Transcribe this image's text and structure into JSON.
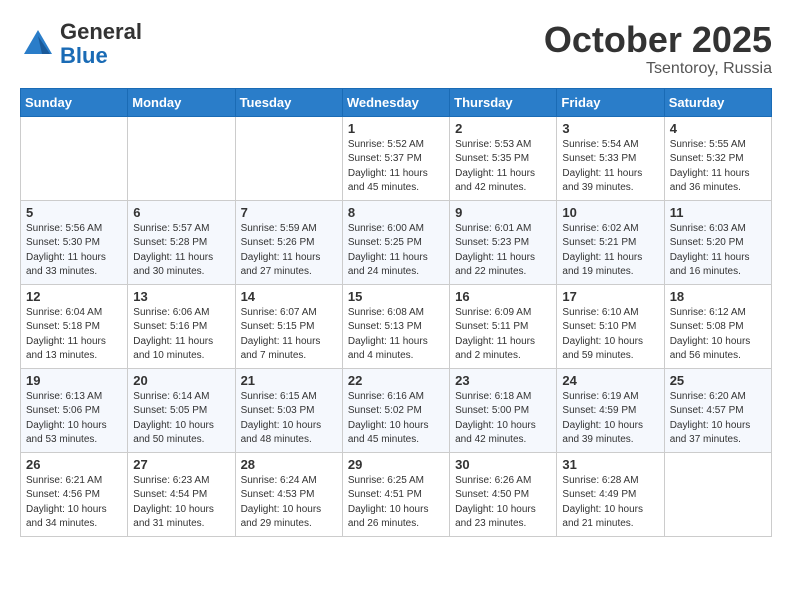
{
  "header": {
    "logo_general": "General",
    "logo_blue": "Blue",
    "month": "October 2025",
    "location": "Tsentoroy, Russia"
  },
  "weekdays": [
    "Sunday",
    "Monday",
    "Tuesday",
    "Wednesday",
    "Thursday",
    "Friday",
    "Saturday"
  ],
  "weeks": [
    [
      {
        "day": "",
        "info": ""
      },
      {
        "day": "",
        "info": ""
      },
      {
        "day": "",
        "info": ""
      },
      {
        "day": "1",
        "info": "Sunrise: 5:52 AM\nSunset: 5:37 PM\nDaylight: 11 hours\nand 45 minutes."
      },
      {
        "day": "2",
        "info": "Sunrise: 5:53 AM\nSunset: 5:35 PM\nDaylight: 11 hours\nand 42 minutes."
      },
      {
        "day": "3",
        "info": "Sunrise: 5:54 AM\nSunset: 5:33 PM\nDaylight: 11 hours\nand 39 minutes."
      },
      {
        "day": "4",
        "info": "Sunrise: 5:55 AM\nSunset: 5:32 PM\nDaylight: 11 hours\nand 36 minutes."
      }
    ],
    [
      {
        "day": "5",
        "info": "Sunrise: 5:56 AM\nSunset: 5:30 PM\nDaylight: 11 hours\nand 33 minutes."
      },
      {
        "day": "6",
        "info": "Sunrise: 5:57 AM\nSunset: 5:28 PM\nDaylight: 11 hours\nand 30 minutes."
      },
      {
        "day": "7",
        "info": "Sunrise: 5:59 AM\nSunset: 5:26 PM\nDaylight: 11 hours\nand 27 minutes."
      },
      {
        "day": "8",
        "info": "Sunrise: 6:00 AM\nSunset: 5:25 PM\nDaylight: 11 hours\nand 24 minutes."
      },
      {
        "day": "9",
        "info": "Sunrise: 6:01 AM\nSunset: 5:23 PM\nDaylight: 11 hours\nand 22 minutes."
      },
      {
        "day": "10",
        "info": "Sunrise: 6:02 AM\nSunset: 5:21 PM\nDaylight: 11 hours\nand 19 minutes."
      },
      {
        "day": "11",
        "info": "Sunrise: 6:03 AM\nSunset: 5:20 PM\nDaylight: 11 hours\nand 16 minutes."
      }
    ],
    [
      {
        "day": "12",
        "info": "Sunrise: 6:04 AM\nSunset: 5:18 PM\nDaylight: 11 hours\nand 13 minutes."
      },
      {
        "day": "13",
        "info": "Sunrise: 6:06 AM\nSunset: 5:16 PM\nDaylight: 11 hours\nand 10 minutes."
      },
      {
        "day": "14",
        "info": "Sunrise: 6:07 AM\nSunset: 5:15 PM\nDaylight: 11 hours\nand 7 minutes."
      },
      {
        "day": "15",
        "info": "Sunrise: 6:08 AM\nSunset: 5:13 PM\nDaylight: 11 hours\nand 4 minutes."
      },
      {
        "day": "16",
        "info": "Sunrise: 6:09 AM\nSunset: 5:11 PM\nDaylight: 11 hours\nand 2 minutes."
      },
      {
        "day": "17",
        "info": "Sunrise: 6:10 AM\nSunset: 5:10 PM\nDaylight: 10 hours\nand 59 minutes."
      },
      {
        "day": "18",
        "info": "Sunrise: 6:12 AM\nSunset: 5:08 PM\nDaylight: 10 hours\nand 56 minutes."
      }
    ],
    [
      {
        "day": "19",
        "info": "Sunrise: 6:13 AM\nSunset: 5:06 PM\nDaylight: 10 hours\nand 53 minutes."
      },
      {
        "day": "20",
        "info": "Sunrise: 6:14 AM\nSunset: 5:05 PM\nDaylight: 10 hours\nand 50 minutes."
      },
      {
        "day": "21",
        "info": "Sunrise: 6:15 AM\nSunset: 5:03 PM\nDaylight: 10 hours\nand 48 minutes."
      },
      {
        "day": "22",
        "info": "Sunrise: 6:16 AM\nSunset: 5:02 PM\nDaylight: 10 hours\nand 45 minutes."
      },
      {
        "day": "23",
        "info": "Sunrise: 6:18 AM\nSunset: 5:00 PM\nDaylight: 10 hours\nand 42 minutes."
      },
      {
        "day": "24",
        "info": "Sunrise: 6:19 AM\nSunset: 4:59 PM\nDaylight: 10 hours\nand 39 minutes."
      },
      {
        "day": "25",
        "info": "Sunrise: 6:20 AM\nSunset: 4:57 PM\nDaylight: 10 hours\nand 37 minutes."
      }
    ],
    [
      {
        "day": "26",
        "info": "Sunrise: 6:21 AM\nSunset: 4:56 PM\nDaylight: 10 hours\nand 34 minutes."
      },
      {
        "day": "27",
        "info": "Sunrise: 6:23 AM\nSunset: 4:54 PM\nDaylight: 10 hours\nand 31 minutes."
      },
      {
        "day": "28",
        "info": "Sunrise: 6:24 AM\nSunset: 4:53 PM\nDaylight: 10 hours\nand 29 minutes."
      },
      {
        "day": "29",
        "info": "Sunrise: 6:25 AM\nSunset: 4:51 PM\nDaylight: 10 hours\nand 26 minutes."
      },
      {
        "day": "30",
        "info": "Sunrise: 6:26 AM\nSunset: 4:50 PM\nDaylight: 10 hours\nand 23 minutes."
      },
      {
        "day": "31",
        "info": "Sunrise: 6:28 AM\nSunset: 4:49 PM\nDaylight: 10 hours\nand 21 minutes."
      },
      {
        "day": "",
        "info": ""
      }
    ]
  ]
}
